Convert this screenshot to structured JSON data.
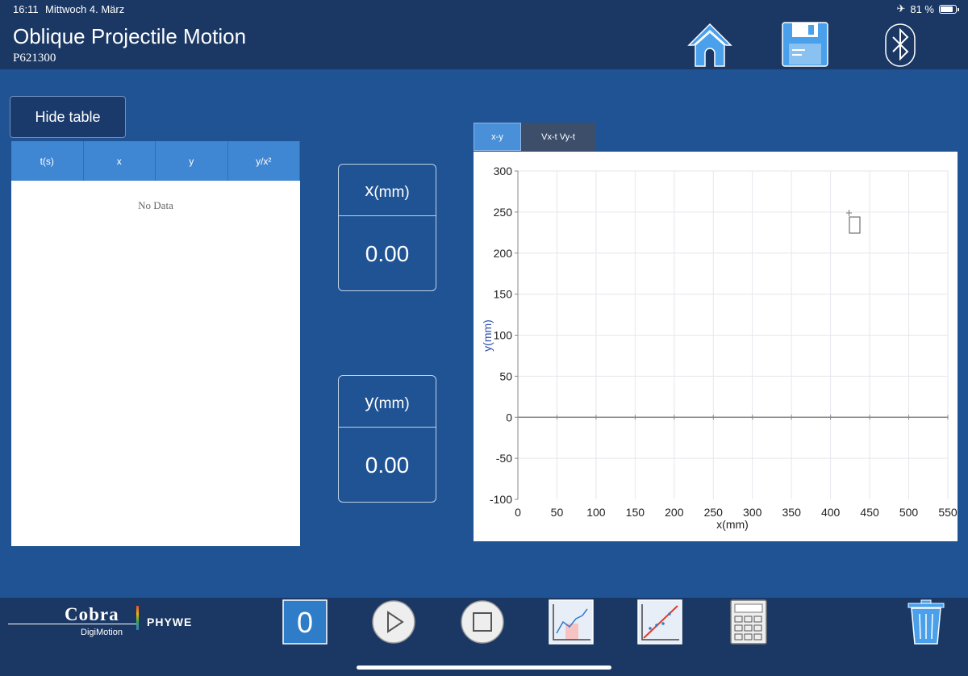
{
  "status": {
    "time": "16:11",
    "date": "Mittwoch 4. März",
    "battery": "81 %",
    "battery_level": 0.81
  },
  "header": {
    "title": "Oblique Projectile Motion",
    "code": "P621300"
  },
  "sidebar": {
    "hide_table_label": "Hide table"
  },
  "table": {
    "columns": [
      "t(s)",
      "x",
      "y",
      "y/x²"
    ],
    "rows": [],
    "empty_text": "No Data"
  },
  "readouts": {
    "x": {
      "symbol": "x",
      "unit": "(mm)",
      "value": "0.00"
    },
    "y": {
      "symbol": "y",
      "unit": "(mm)",
      "value": "0.00"
    }
  },
  "chart_tabs": [
    {
      "label": "x-y",
      "active": true
    },
    {
      "label": "Vx-t Vy-t",
      "active": false
    }
  ],
  "chart_data": {
    "type": "scatter",
    "title": "",
    "xlabel": "x(mm)",
    "ylabel": "y(mm)",
    "xlim": [
      0,
      550
    ],
    "ylim": [
      -100,
      300
    ],
    "xticks": [
      0,
      50,
      100,
      150,
      200,
      250,
      300,
      350,
      400,
      450,
      500,
      550
    ],
    "yticks": [
      -100,
      -50,
      0,
      50,
      100,
      150,
      200,
      250,
      300
    ],
    "grid": true,
    "series": [
      {
        "x": [],
        "y": []
      }
    ]
  },
  "footer": {
    "brand": "Cobra",
    "product": "DigiMotion",
    "company": "PHYWE",
    "zero_label": "0"
  },
  "colors": {
    "header_bg": "#1b3864",
    "page_bg": "#1f5394",
    "table_header": "#3f86d3",
    "accent": "#4a90d9"
  }
}
